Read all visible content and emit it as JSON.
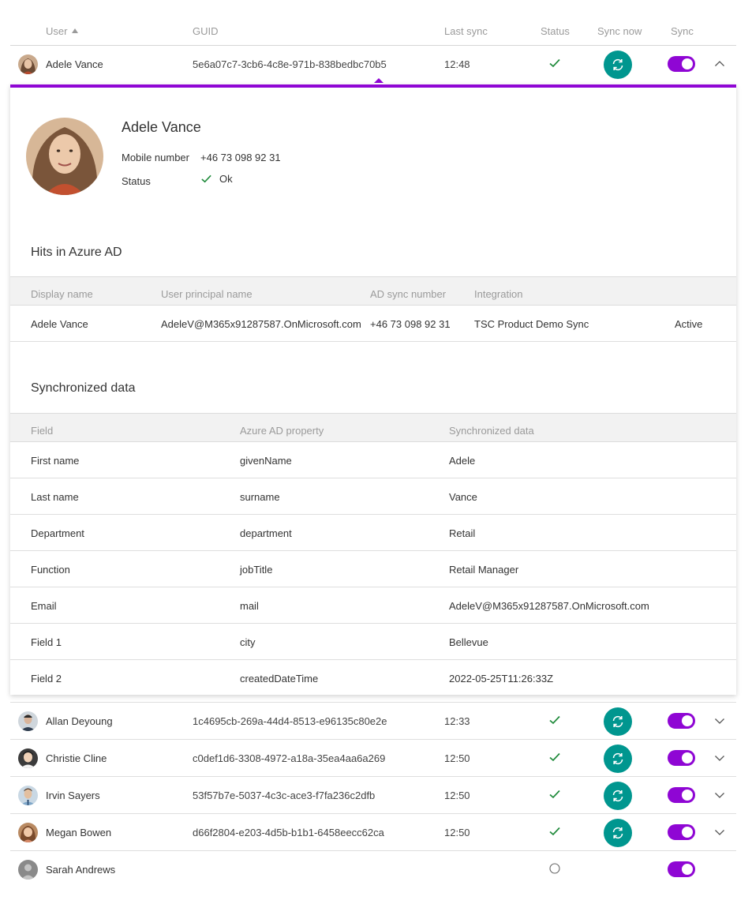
{
  "colors": {
    "accent": "#8f06d4",
    "sync_button": "#00968f",
    "ok": "#1e8a3a"
  },
  "table": {
    "headers": {
      "user": "User",
      "guid": "GUID",
      "last_sync": "Last sync",
      "status": "Status",
      "sync_now": "Sync now",
      "sync": "Sync"
    },
    "sorted_by": "user",
    "rows": [
      {
        "name": "Adele Vance",
        "guid": "5e6a07c7-3cb6-4c8e-971b-838bedbc70b5",
        "last_sync": "12:48",
        "status": "ok",
        "sync_enabled": true,
        "expanded": true
      },
      {
        "name": "Allan Deyoung",
        "guid": "1c4695cb-269a-44d4-8513-e96135c80e2e",
        "last_sync": "12:33",
        "status": "ok",
        "sync_enabled": true,
        "expanded": false
      },
      {
        "name": "Christie Cline",
        "guid": "c0def1d6-3308-4972-a18a-35ea4aa6a269",
        "last_sync": "12:50",
        "status": "ok",
        "sync_enabled": true,
        "expanded": false
      },
      {
        "name": "Irvin Sayers",
        "guid": "53f57b7e-5037-4c3c-ace3-f7fa236c2dfb",
        "last_sync": "12:50",
        "status": "ok",
        "sync_enabled": true,
        "expanded": false
      },
      {
        "name": "Megan Bowen",
        "guid": "d66f2804-e203-4d5b-b1b1-6458eecc62ca",
        "last_sync": "12:50",
        "status": "ok",
        "sync_enabled": true,
        "expanded": false
      },
      {
        "name": "Sarah Andrews",
        "guid": "",
        "last_sync": "",
        "status": "pending",
        "sync_enabled": true,
        "expanded": false
      }
    ]
  },
  "detail": {
    "name": "Adele Vance",
    "mobile_label": "Mobile number",
    "mobile_value": "+46 73 098 92 31",
    "status_label": "Status",
    "status_value": "Ok",
    "hits_title": "Hits in Azure AD",
    "hits_headers": {
      "display_name": "Display name",
      "upn": "User principal name",
      "ad_sync_number": "AD sync number",
      "integration": "Integration"
    },
    "hits": [
      {
        "display_name": "Adele Vance",
        "upn": "AdeleV@M365x91287587.OnMicrosoft.com",
        "ad_sync_number": "+46 73 098 92 31",
        "integration": "TSC Product Demo Sync",
        "state": "Active"
      }
    ],
    "sync_title": "Synchronized data",
    "sync_headers": {
      "field": "Field",
      "property": "Azure AD property",
      "data": "Synchronized data"
    },
    "sync_rows": [
      {
        "field": "First name",
        "property": "givenName",
        "data": "Adele"
      },
      {
        "field": "Last name",
        "property": "surname",
        "data": "Vance"
      },
      {
        "field": "Department",
        "property": "department",
        "data": "Retail"
      },
      {
        "field": "Function",
        "property": "jobTitle",
        "data": "Retail Manager"
      },
      {
        "field": "Email",
        "property": "mail",
        "data": "AdeleV@M365x91287587.OnMicrosoft.com"
      },
      {
        "field": "Field 1",
        "property": "city",
        "data": "Bellevue"
      },
      {
        "field": "Field 2",
        "property": "createdDateTime",
        "data": "2022-05-25T11:26:33Z"
      }
    ]
  }
}
